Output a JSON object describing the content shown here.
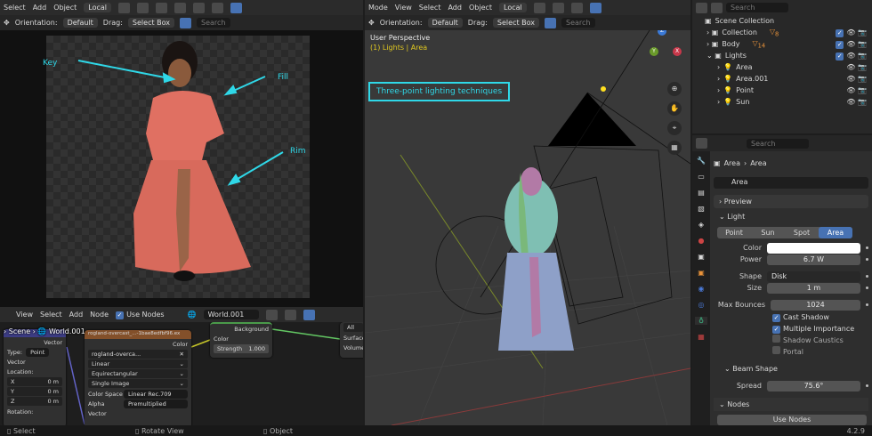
{
  "left_header": {
    "menus": [
      "Select",
      "Add",
      "Object"
    ],
    "pivot": "Local",
    "orientation_label": "Orientation:",
    "orientation": "Default",
    "drag_label": "Drag:",
    "drag": "Select Box",
    "search_placeholder": "Search"
  },
  "image_annotations": {
    "key": "Key",
    "fill": "Fill",
    "rim": "Rim"
  },
  "node_editor": {
    "menus": [
      "View",
      "Select",
      "Add",
      "Node"
    ],
    "use_nodes": "Use Nodes",
    "world": "World.001",
    "breadcrumb": [
      "Scene",
      "World.001"
    ],
    "mapping": {
      "title": "Mapping",
      "out": "Vector",
      "type_label": "Type:",
      "type": "Point",
      "vector": "Vector",
      "location": "Location:",
      "x": "X",
      "y": "Y",
      "z": "Z",
      "loc_val": "0 m",
      "rotation": "Rotation:"
    },
    "env": {
      "title": "rogland-overcast_...-1bae8edfbf96.ex",
      "out": "Color",
      "image": "rogland-overca...",
      "interp": "Linear",
      "proj": "Equirectangular",
      "source": "Single Image",
      "cs_label": "Color Space",
      "cs": "Linear Rec.709",
      "alpha_label": "Alpha",
      "alpha": "Premultiplied",
      "vector": "Vector"
    },
    "bg": {
      "out": "Background",
      "color": "Color",
      "strength_label": "Strength",
      "strength": "1.000"
    },
    "output": {
      "target": "All",
      "surface": "Surface",
      "volume": "Volume"
    }
  },
  "viewport": {
    "menus": [
      "Mode",
      "View",
      "Select",
      "Add",
      "Object"
    ],
    "pivot": "Local",
    "orientation_label": "Orientation:",
    "orientation": "Default",
    "drag_label": "Drag:",
    "drag": "Select Box",
    "search_placeholder": "Search",
    "view_name": "User Perspective",
    "context": "(1) Lights | Area",
    "caption": "Three-point lighting techniques",
    "gizmo": {
      "x": "X",
      "y": "Y",
      "z": "Z"
    }
  },
  "outliner": {
    "search_placeholder": "Search",
    "root": "Scene Collection",
    "items": [
      {
        "name": "Collection",
        "badge": "8"
      },
      {
        "name": "Body",
        "badge": "14"
      },
      {
        "name": "Lights"
      }
    ],
    "lights": [
      "Area",
      "Area.001",
      "Point",
      "Sun"
    ]
  },
  "properties": {
    "search_placeholder": "Search",
    "breadcrumb": [
      "Area",
      "Area"
    ],
    "datablock": "Area",
    "preview": "Preview",
    "light": "Light",
    "types": [
      "Point",
      "Sun",
      "Spot",
      "Area"
    ],
    "active_type": "Area",
    "color_label": "Color",
    "color": "#ffffff",
    "power_label": "Power",
    "power": "6.7 W",
    "shape_label": "Shape",
    "shape": "Disk",
    "size_label": "Size",
    "size": "1 m",
    "bounces_label": "Max Bounces",
    "bounces": "1024",
    "checks": [
      {
        "label": "Cast Shadow",
        "on": true
      },
      {
        "label": "Multiple Importance",
        "on": true
      },
      {
        "label": "Shadow Caustics",
        "on": false
      },
      {
        "label": "Portal",
        "on": false
      }
    ],
    "beam": "Beam Shape",
    "spread_label": "Spread",
    "spread": "75.6°",
    "nodes": "Nodes",
    "use_nodes": "Use Nodes"
  },
  "status": {
    "select": "Select",
    "rotate": "Rotate View",
    "object": "Object",
    "version": "4.2.9"
  }
}
